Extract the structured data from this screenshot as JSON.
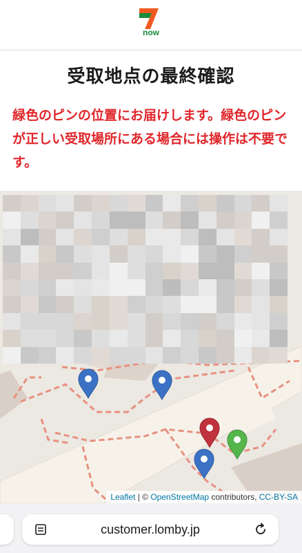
{
  "header": {
    "logo_number": "7",
    "logo_text": "now"
  },
  "page": {
    "title": "受取地点の最終確認",
    "instruction": "緑色のピンの位置にお届けします。緑色のピンが正しい受取場所にある場合には操作は不要です。"
  },
  "map": {
    "attribution": {
      "leaflet": "Leaflet",
      "separator": " | © ",
      "osm": "OpenStreetMap",
      "contributors": " contributors, ",
      "license": "CC-BY-SA"
    },
    "pins": [
      {
        "name": "blue-pin",
        "color": "#3b72c5"
      },
      {
        "name": "blue-pin",
        "color": "#3b72c5"
      },
      {
        "name": "red-pin",
        "color": "#c0333d"
      },
      {
        "name": "green-pin",
        "color": "#55b64c"
      },
      {
        "name": "blue-pin",
        "color": "#3b72c5"
      }
    ],
    "colors": {
      "path": "#e89080",
      "road": "#f6f2e9",
      "building": "#d7ccc4"
    }
  },
  "browser": {
    "url": "customer.lomby.jp"
  },
  "colors": {
    "accent_red": "#e0262b",
    "logo_orange": "#f05a22",
    "logo_green": "#1a8b3a"
  }
}
